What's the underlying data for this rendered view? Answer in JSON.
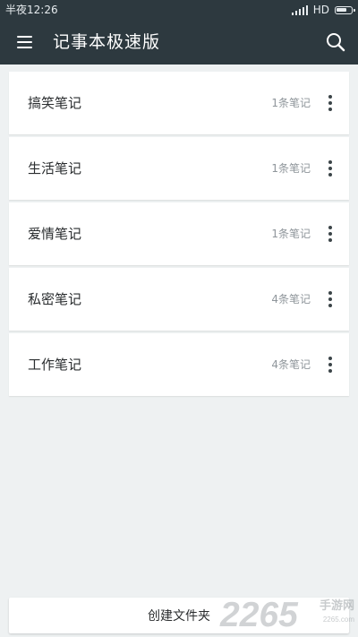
{
  "status_bar": {
    "time": "半夜12:26",
    "network": "HD",
    "battery_level": 0.75
  },
  "app_bar": {
    "title": "记事本极速版",
    "menu_icon": "menu-icon",
    "search_icon": "search-icon"
  },
  "folders": [
    {
      "name": "搞笑笔记",
      "count": "1条笔记"
    },
    {
      "name": "生活笔记",
      "count": "1条笔记"
    },
    {
      "name": "爱情笔记",
      "count": "1条笔记"
    },
    {
      "name": "私密笔记",
      "count": "4条笔记"
    },
    {
      "name": "工作笔记",
      "count": "4条笔记"
    }
  ],
  "bottom": {
    "create_button": "创建文件夹"
  },
  "watermark": {
    "number": "2265",
    "text": "手游网",
    "url": "2265.com"
  },
  "colors": {
    "primary": "#2d393f",
    "background": "#eef1f2",
    "card": "#ffffff",
    "title_text": "#ffffff",
    "count_text": "#8f969b"
  }
}
